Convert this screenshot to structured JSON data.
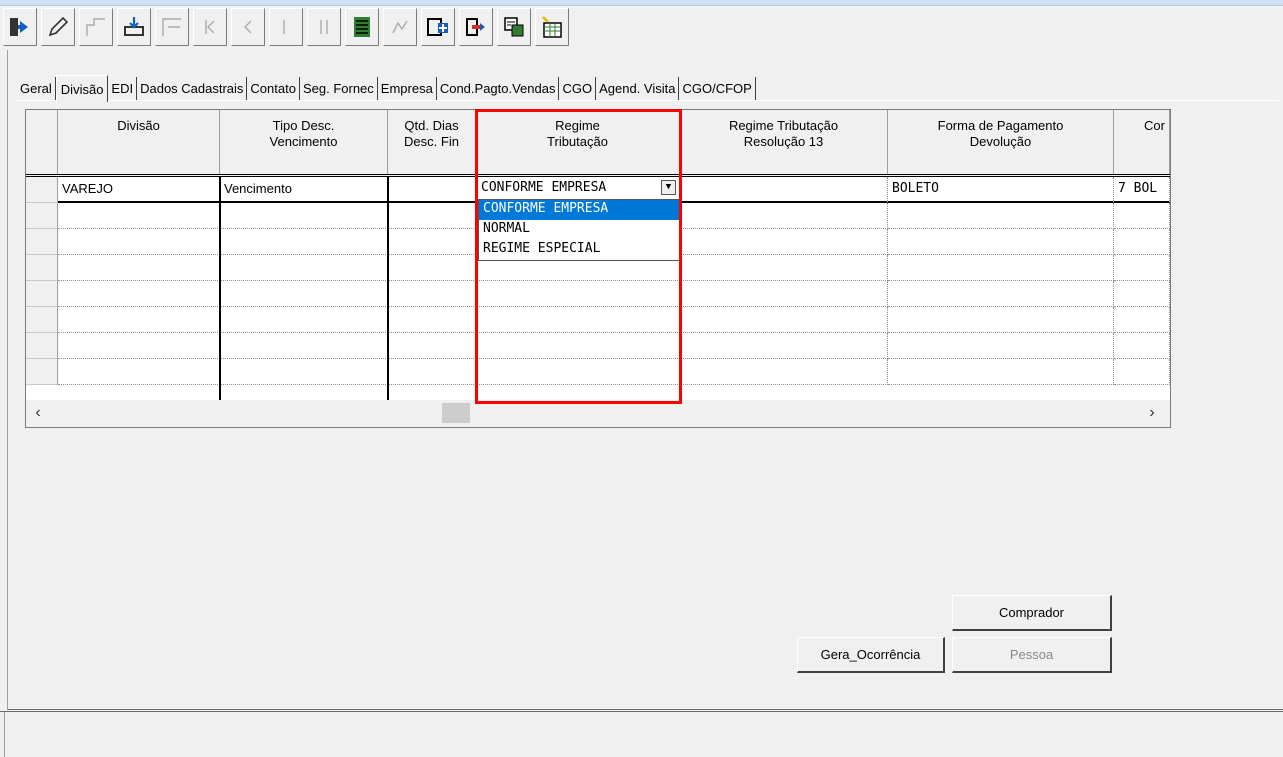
{
  "toolbar": {
    "buttons": [
      "exit-icon",
      "edit-icon",
      "new-icon",
      "save-icon",
      "delete-icon",
      "first-icon",
      "previous-icon",
      "next-icon",
      "last-icon",
      "grid-icon",
      "find-icon",
      "add-record-icon",
      "export-icon",
      "report-icon",
      "calendar-icon"
    ]
  },
  "tabs": [
    "Geral",
    "Divisão",
    "EDI",
    "Dados Cadastrais",
    "Contato",
    "Seg. Fornec",
    "Empresa",
    "Cond.Pagto.Vendas",
    "CGO",
    "Agend. Visita",
    "CGO/CFOP"
  ],
  "active_tab": "Divisão",
  "grid": {
    "columns": [
      {
        "label": "Divisão"
      },
      {
        "label": "Tipo Desc.\nVencimento"
      },
      {
        "label": "Qtd. Dias\nDesc. Fin"
      },
      {
        "label": "Regime\nTributação"
      },
      {
        "label": "Regime Tributação\nResolução 13"
      },
      {
        "label": "Forma de Pagamento\nDevolução"
      },
      {
        "label": "Cor"
      }
    ],
    "rows": [
      [
        "VAREJO",
        "Vencimento",
        "",
        "CONFORME EMPRESA",
        "",
        "BOLETO",
        "7 BOL"
      ]
    ]
  },
  "dropdown": {
    "current": "CONFORME EMPRESA",
    "options": [
      "CONFORME EMPRESA",
      "NORMAL",
      "REGIME ESPECIAL"
    ],
    "selected_index": 0
  },
  "buttons": {
    "comprador": "Comprador",
    "gera_ocorrencia": "Gera_Ocorrência",
    "pessoa": "Pessoa"
  }
}
